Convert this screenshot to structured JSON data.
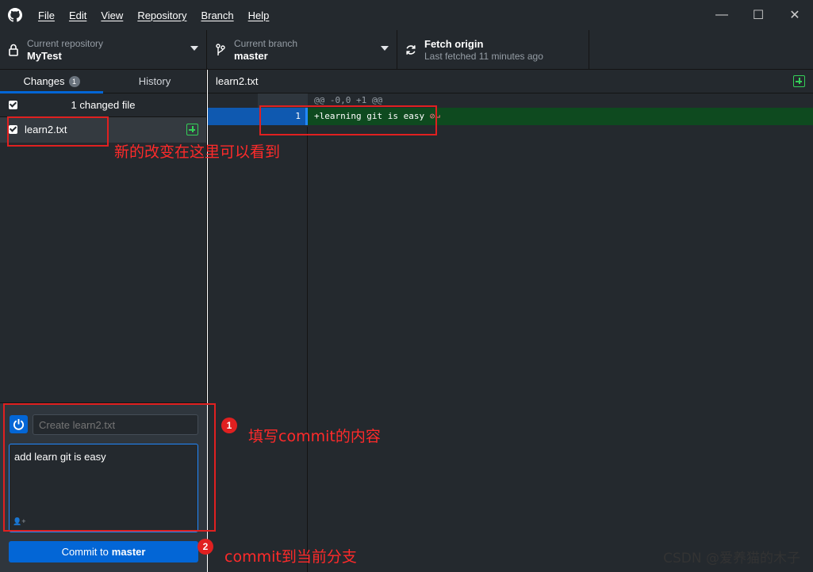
{
  "menu": [
    "File",
    "Edit",
    "View",
    "Repository",
    "Branch",
    "Help"
  ],
  "window_controls": [
    "—",
    "☐",
    "✕"
  ],
  "toolbar": {
    "repo_label": "Current repository",
    "repo_value": "MyTest",
    "branch_label": "Current branch",
    "branch_value": "master",
    "fetch_title": "Fetch origin",
    "fetch_sub": "Last fetched 11 minutes ago"
  },
  "tabs": {
    "changes": "Changes",
    "changes_count": "1",
    "history": "History"
  },
  "changes": {
    "header": "1 changed file",
    "files": [
      {
        "name": "learn2.txt",
        "status": "added"
      }
    ]
  },
  "commit": {
    "summary_placeholder": "Create learn2.txt",
    "description": "add learn git is easy",
    "button_prefix": "Commit to",
    "button_branch": "master"
  },
  "diff": {
    "file": "learn2.txt",
    "hunk": "@@ -0,0 +1 @@",
    "line_number": "1",
    "line_text": "+learning git is easy",
    "no_eol_marker": "⊘↵"
  },
  "annotations": {
    "note_file": "新的改变在这里可以看到",
    "badge1": "1",
    "note_commit_msg": "填写commit的内容",
    "badge2": "2",
    "note_commit_btn": "commit到当前分支"
  },
  "watermark": "CSDN @爱养猫的木子",
  "colors": {
    "accent": "#0366d6",
    "annotation": "#e02020",
    "added": "#34d058"
  },
  "icons": {
    "logo": "github-logo-icon",
    "repo": "lock-icon",
    "branch": "branch-icon",
    "fetch": "sync-icon",
    "avatar": "power-icon"
  }
}
